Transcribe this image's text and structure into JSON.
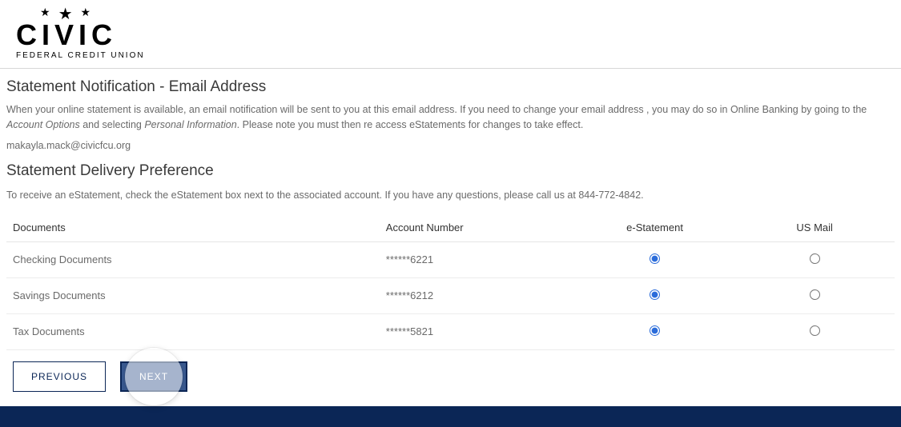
{
  "brand": {
    "word": "CIVIC",
    "subtitle": "FEDERAL CREDIT UNION"
  },
  "notification": {
    "heading": "Statement Notification - Email Address",
    "body_pre": "When your online statement is available, an email notification will be sent to you at this email address. If you need to change your email address , you may do so in Online Banking by going to the ",
    "italic1": "Account Options",
    "body_mid": " and selecting ",
    "italic2": "Personal Information",
    "body_post": ". Please note you must then re access eStatements for changes to take effect.",
    "email": "makayla.mack@civicfcu.org"
  },
  "delivery": {
    "heading": "Statement Delivery Preference",
    "body": "To receive an eStatement, check the eStatement box next to the associated account. If you have any questions, please call us at 844-772-4842."
  },
  "table": {
    "headers": {
      "documents": "Documents",
      "account_number": "Account Number",
      "e_statement": "e-Statement",
      "us_mail": "US Mail"
    },
    "rows": [
      {
        "doc_label": "Checking Documents",
        "account": "******6221",
        "selected": "estatement"
      },
      {
        "doc_label": "Savings Documents",
        "account": "******6212",
        "selected": "estatement"
      },
      {
        "doc_label": "Tax Documents",
        "account": "******5821",
        "selected": "estatement"
      }
    ]
  },
  "buttons": {
    "previous": "PREVIOUS",
    "next": "NEXT"
  }
}
